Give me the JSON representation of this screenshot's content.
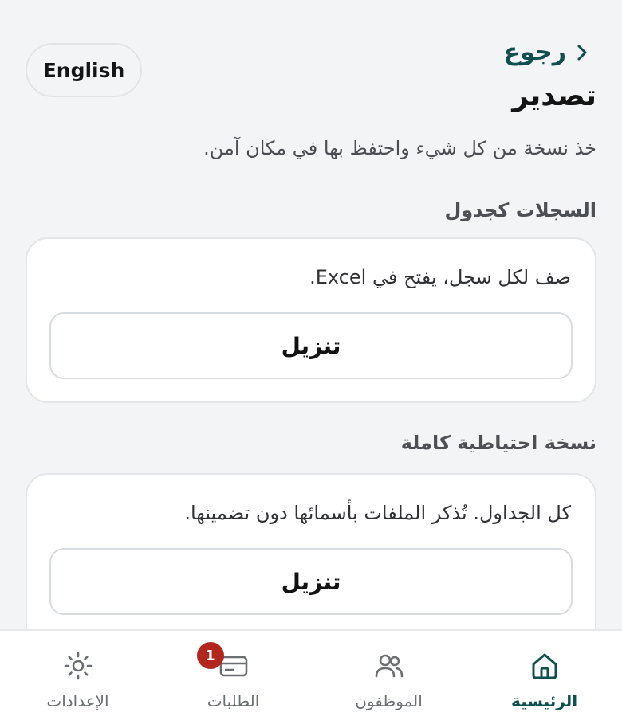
{
  "header": {
    "back_label": "رجوع",
    "title": "تصدير",
    "language_button": "English"
  },
  "subtitle": "خذ نسخة من كل شيء واحتفظ بها في مكان آمن.",
  "sections": [
    {
      "heading": "السجلات كجدول",
      "description": "صف لكل سجل، يفتح في Excel.",
      "button_label": "تنزيل"
    },
    {
      "heading": "نسخة احتياطية كاملة",
      "description": "كل الجداول. تُذكر الملفات بأسمائها دون تضمينها.",
      "button_label": "تنزيل"
    }
  ],
  "bottom_nav": {
    "items": [
      {
        "label": "الرئيسية",
        "icon": "home-icon",
        "active": true
      },
      {
        "label": "الموظفون",
        "icon": "people-icon",
        "active": false
      },
      {
        "label": "الطلبات",
        "icon": "card-icon",
        "active": false,
        "badge": "1"
      },
      {
        "label": "الإعدادات",
        "icon": "sun-settings-icon",
        "active": false
      }
    ]
  },
  "colors": {
    "accent": "#0f4f4f",
    "badge": "#b3261e",
    "background": "#f3f4f6"
  }
}
